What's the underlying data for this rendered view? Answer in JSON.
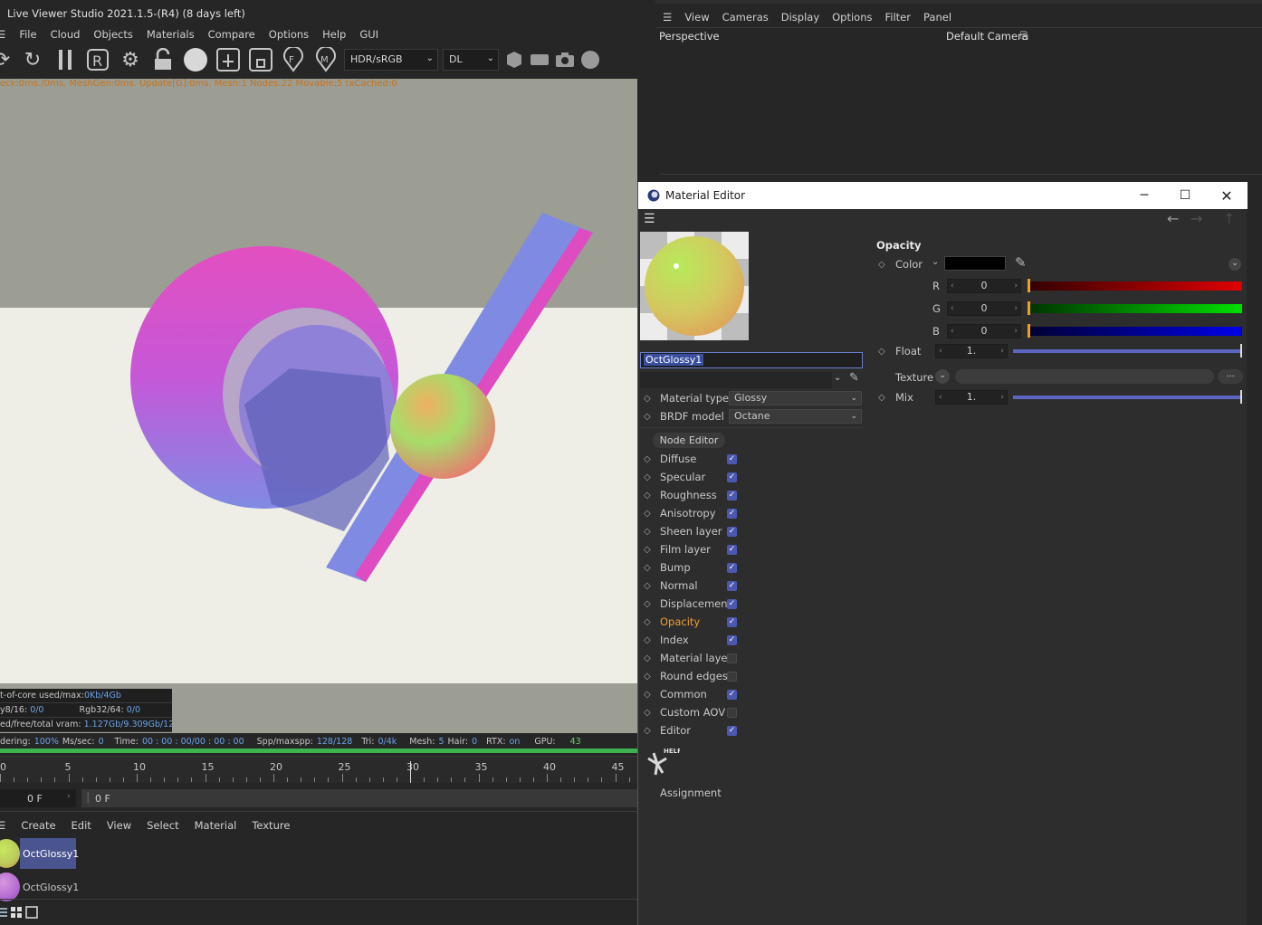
{
  "live_viewer": {
    "title": "Live Viewer Studio 2021.1.5-(R4) (8 days left)",
    "menu": [
      "File",
      "Cloud",
      "Objects",
      "Materials",
      "Compare",
      "Options",
      "Help",
      "GUI"
    ],
    "toolbar": {
      "icons": [
        "refresh-icon",
        "sync-icon",
        "pause-icon",
        "region-render-icon",
        "settings-gear-icon",
        "lock-icon",
        "material-ball-icon",
        "add-region-icon",
        "crop-icon",
        "focus-pick-icon",
        "material-pick-icon"
      ],
      "color_space": "HDR/sRGB",
      "kernel": "DL",
      "extra_icons": [
        "clay-mode-icon",
        "film-icon",
        "camera-icon",
        "sphere-icon"
      ]
    },
    "status_line": "eck:0ms./0ms. MeshGen:0ms. Update[G]:0ms. Mesh:1 Nodes:22 Movable:5 txCached:0",
    "info_box": {
      "out_of_core_label": "t-of-core used/max:",
      "out_of_core_value": "0Kb/4Gb",
      "grey8_label": "y8/16:",
      "grey8_value": "0/0",
      "rgb_label": "Rgb32/64:",
      "rgb_value": "0/0",
      "vram_label": "ed/free/total vram:",
      "vram_value": "1.127Gb/9.309Gb/12Gb"
    },
    "bottom_status": {
      "rendering_label": "dering:",
      "rendering_value": "100%",
      "mssec_label": "Ms/sec:",
      "mssec_value": "0",
      "time_label": "Time:",
      "time_value": "00 : 00 : 00/00 : 00 : 00",
      "spp_label": "Spp/maxspp:",
      "spp_value": "128/128",
      "tri_label": "Tri:",
      "tri_value": "0/4k",
      "mesh_label": "Mesh:",
      "mesh_value": "5",
      "hair_label": "Hair:",
      "hair_value": "0",
      "rtx_label": "RTX:",
      "rtx_value": "on",
      "gpu_label": "GPU:",
      "gpu_value": "43"
    },
    "render_progress": 1.0
  },
  "timeline": {
    "ticks": [
      "0",
      "5",
      "10",
      "15",
      "20",
      "25",
      "30",
      "35",
      "40",
      "45"
    ],
    "current_frame": "0 F",
    "range_start": "0 F"
  },
  "material_manager": {
    "menu": [
      "Create",
      "Edit",
      "View",
      "Select",
      "Material",
      "Texture"
    ],
    "materials": [
      {
        "name": "OctGlossy1",
        "selected": true,
        "color": "#b9c95a"
      },
      {
        "name": "OctGlossy1",
        "selected": false,
        "color": "#b46ad0"
      }
    ]
  },
  "viewport": {
    "menu": [
      "View",
      "Cameras",
      "Display",
      "Options",
      "Filter",
      "Panel"
    ],
    "view_name": "Perspective",
    "camera": "Default Camera"
  },
  "material_editor": {
    "title": "Material Editor",
    "material_name": "OctGlossy1",
    "material_type_label": "Material type",
    "material_type_value": "Glossy",
    "brdf_label": "BRDF model",
    "brdf_value": "Octane",
    "node_editor_label": "Node Editor",
    "channels": [
      {
        "label": "Diffuse",
        "checked": true,
        "active": false
      },
      {
        "label": "Specular",
        "checked": true,
        "active": false
      },
      {
        "label": "Roughness",
        "checked": true,
        "active": false
      },
      {
        "label": "Anisotropy",
        "checked": true,
        "active": false
      },
      {
        "label": "Sheen layer",
        "checked": true,
        "active": false
      },
      {
        "label": "Film layer",
        "checked": true,
        "active": false
      },
      {
        "label": "Bump",
        "checked": true,
        "active": false
      },
      {
        "label": "Normal",
        "checked": true,
        "active": false
      },
      {
        "label": "Displacement",
        "checked": true,
        "active": false
      },
      {
        "label": "Opacity",
        "checked": true,
        "active": true
      },
      {
        "label": "Index",
        "checked": true,
        "active": false
      },
      {
        "label": "Material layer",
        "checked": false,
        "active": false
      },
      {
        "label": "Round edges",
        "checked": false,
        "active": false
      },
      {
        "label": "Common",
        "checked": true,
        "active": false
      },
      {
        "label": "Custom AOV",
        "checked": false,
        "active": false
      },
      {
        "label": "Editor",
        "checked": true,
        "active": false
      }
    ],
    "help_label": "HELP",
    "assignment_label": "Assignment",
    "opacity": {
      "section_title": "Opacity",
      "color_label": "Color",
      "color_value": "#000000",
      "r_label": "R",
      "r_value": "0",
      "g_label": "G",
      "g_value": "0",
      "b_label": "B",
      "b_value": "0",
      "float_label": "Float",
      "float_value": "1.",
      "texture_label": "Texture",
      "texture_button": "...",
      "mix_label": "Mix",
      "mix_value": "1."
    }
  }
}
